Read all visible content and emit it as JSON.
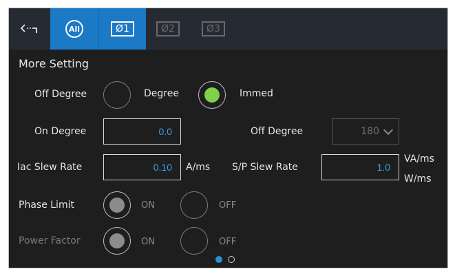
{
  "toolbar": {
    "back_icon": "back-arrow-icon",
    "all_label": "All",
    "phase1_label": "Ø1",
    "phase2_label": "Ø2",
    "phase3_label": "Ø3",
    "accent_color": "#1b79c6"
  },
  "panel": {
    "title": "More Setting",
    "mode": {
      "off_degree_label": "Off Degree",
      "degree_label": "Degree",
      "immed_label": "Immed",
      "selected": "Immed"
    },
    "on_degree": {
      "label": "On Degree",
      "value": "0.0"
    },
    "off_degree": {
      "label": "Off Degree",
      "value": "180"
    },
    "iac_slew_rate": {
      "label": "Iac Slew Rate",
      "value": "0.10",
      "unit": "A/ms"
    },
    "sp_slew_rate": {
      "label": "S/P Slew Rate",
      "value": "1.0",
      "unit_top": "VA/ms",
      "unit_bottom": "W/ms"
    },
    "phase_limit": {
      "label": "Phase Limit",
      "on_label": "ON",
      "off_label": "OFF",
      "selected": "ON"
    },
    "power_factor": {
      "label": "Power Factor",
      "on_label": "ON",
      "off_label": "OFF",
      "selected": "ON"
    }
  },
  "pager": {
    "current_page": 1,
    "total_pages": 2
  },
  "colors": {
    "selected_green": "#7ed14b",
    "value_blue": "#3a9ee6",
    "background": "#1e1e1e"
  }
}
